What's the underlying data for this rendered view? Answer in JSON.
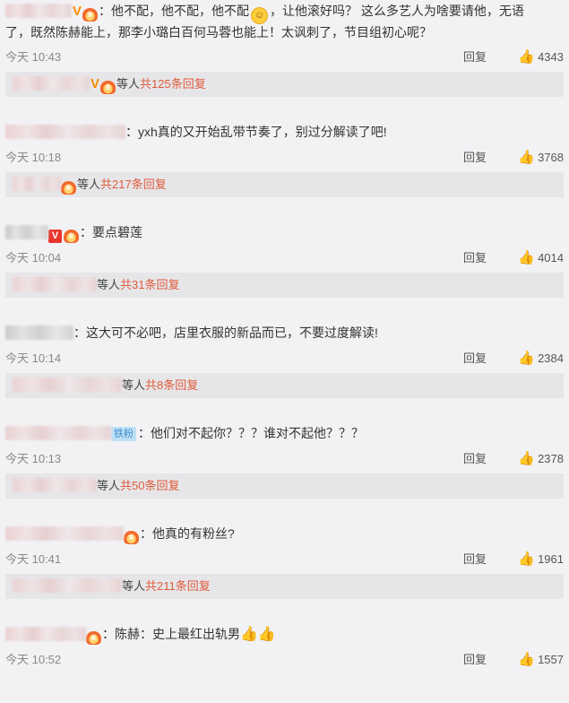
{
  "ui": {
    "reply_label": "回复",
    "others_label": "等人"
  },
  "comments": [
    {
      "text_line1": "：他不配，他不配，他不配",
      "text_line1b": "，让他滚好吗？ 这么多艺人为啥要请他，无语",
      "text_line2": "了，既然陈赫能上，那李小璐白百何马蓉也能上！太讽刺了，节目组初心呢？",
      "time": "今天 10:43",
      "likes": "4343",
      "subreplies": "共125条回复"
    },
    {
      "text_line1": "：yxh真的又开始乱带节奏了，别过分解读了吧!",
      "time": "今天 10:18",
      "likes": "3768",
      "subreplies": "共217条回复"
    },
    {
      "text_line1": "：要点碧莲",
      "time": "今天 10:04",
      "likes": "4014",
      "subreplies": "共31条回复"
    },
    {
      "text_line1": "：这大可不必吧，店里衣服的新品而已，不要过度解读!",
      "time": "今天 10:14",
      "likes": "2384",
      "subreplies": "共8条回复"
    },
    {
      "badge": "铁粉",
      "text_line1": "：他们对不起你？？？谁对不起他？？？",
      "time": "今天 10:13",
      "likes": "2378",
      "subreplies": "共50条回复"
    },
    {
      "text_line1": "：他真的有粉丝?",
      "time": "今天 10:41",
      "likes": "1961",
      "subreplies": "共211条回复"
    },
    {
      "text_line1": "：陈赫：史上最红出轨男",
      "time": "今天 10:52",
      "likes": "1557"
    }
  ],
  "icons": {
    "like": "thumbs-up-icon",
    "verified": "v-badge-icon",
    "member": "crown-icon",
    "emoji_smile": "smiley-icon",
    "emoji_thumb": "thumb-emoji-icon"
  },
  "colors": {
    "background": "#f2f2f5",
    "reply_box": "#e6e6e9",
    "subreply_count": "#e05a3a",
    "verified": "#ff8a00"
  }
}
